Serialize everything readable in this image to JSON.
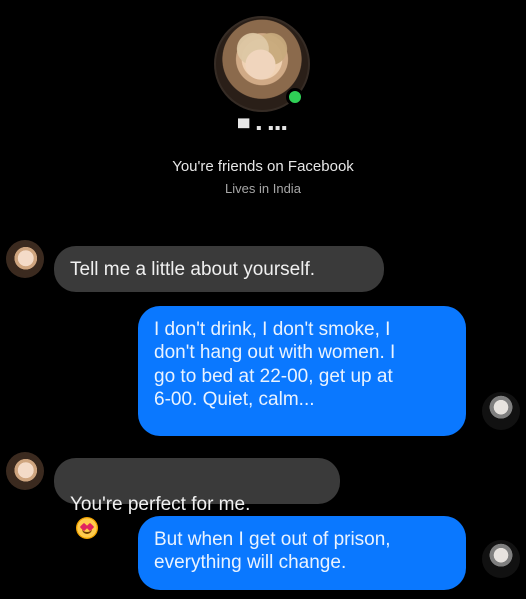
{
  "profile": {
    "name": "▀ ▪ ▪▪▪",
    "friends_text": "You're friends on Facebook",
    "lives_text": "Lives in India",
    "online_color": "#2fd056"
  },
  "messages": [
    {
      "side": "incoming",
      "avatar": "woman-avatar",
      "text": "Tell me a little about yourself."
    },
    {
      "side": "outgoing",
      "avatar": "man-avatar",
      "text": "I don't drink, I don't smoke, I\ndon't hang out with women. I\ngo to bed at 22-00, get up at\n6-00. Quiet, calm..."
    },
    {
      "side": "incoming",
      "avatar": "woman-avatar",
      "text": "You're perfect for me.",
      "emoji": "heart-eyes-emoji"
    },
    {
      "side": "outgoing",
      "avatar": "man-avatar",
      "text": "But when I get out of prison,\neverything will change."
    }
  ],
  "colors": {
    "background": "#000000",
    "incoming_bubble": "#3a3a3a",
    "outgoing_bubble": "#0a78ff"
  }
}
